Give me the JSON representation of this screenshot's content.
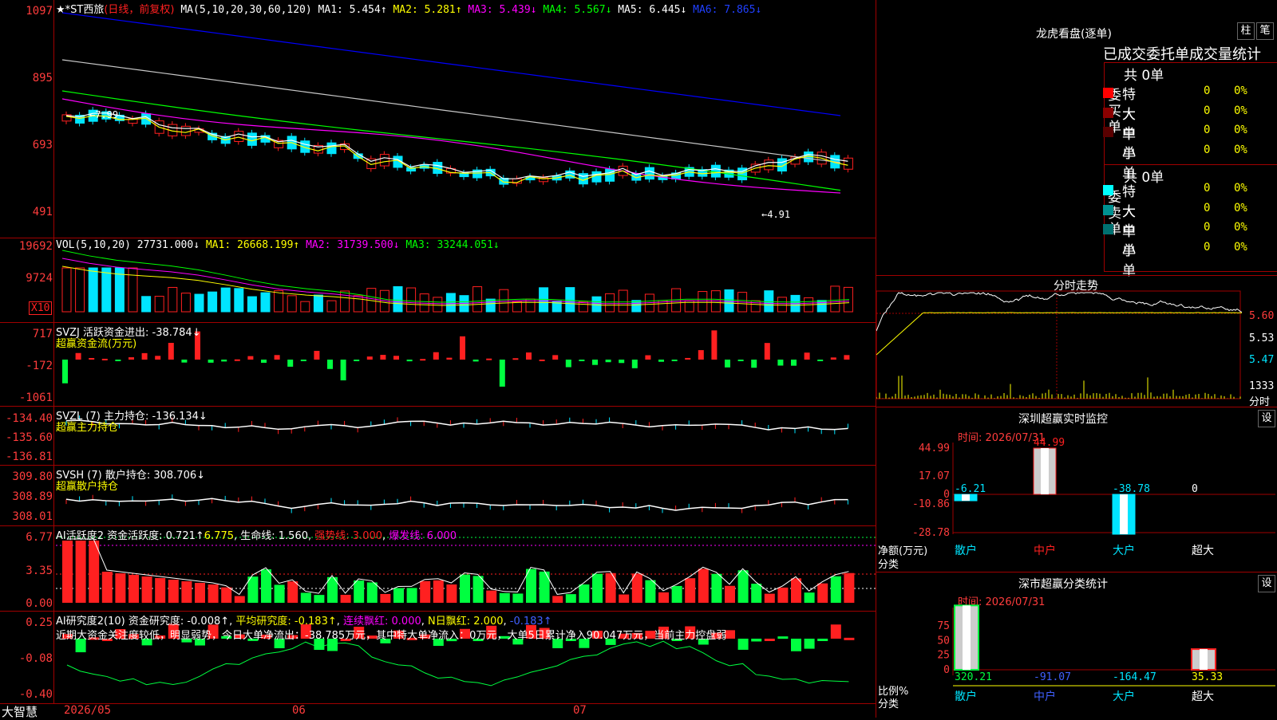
{
  "colors": {
    "up": "#ff2020",
    "down": "#00e5ff",
    "green": "#00ff40",
    "ma1": "#ffffff",
    "ma2": "#ffff00",
    "ma3": "#ff00ff",
    "ma4": "#00ff00",
    "ma5": "#ffffff",
    "ma6": "#0000ff",
    "yellow": "#ffff00",
    "grid": "#a00000"
  },
  "kline": {
    "title_star": "★*ST西旅",
    "period": "(日线，前复权)",
    "ma_label": "MA(5,10,20,30,60,120)",
    "ma1": "MA1: 5.454↑",
    "ma2": "MA2: 5.281↑",
    "ma3": "MA3: 5.439↓",
    "ma4": "MA4: 5.567↓",
    "ma5": "MA5: 6.445↓",
    "ma6": "MA6: 7.865↓",
    "y_ticks": [
      "1097",
      "895",
      "693",
      "491"
    ],
    "high_label": "←7.99",
    "low_label": "←4.91"
  },
  "vol": {
    "label": "VOL(5,10,20)",
    "value": "27731.000↓",
    "ma1": "MA1: 26668.199↑",
    "ma2": "MA2: 31739.500↓",
    "ma3": "MA3: 33244.051↓",
    "y_ticks": [
      "19692",
      "9724"
    ],
    "unit": "X10"
  },
  "svzj": {
    "label": "SVZJ  活跃资金进出: -38.784↓",
    "sub": "超赢资金流(万元)",
    "y_ticks": [
      "717",
      "-172",
      "-1061"
    ]
  },
  "svzl": {
    "label": "SVZL (7) 主力持仓: -136.134↓",
    "sub": "超赢主力持仓",
    "y_ticks": [
      "-134.40",
      "-135.60",
      "-136.81"
    ]
  },
  "svsh": {
    "label": "SVSH (7) 散户持仓: 308.706↓",
    "sub": "超赢散户持仓",
    "y_ticks": [
      "309.80",
      "308.89",
      "308.01"
    ]
  },
  "ai1": {
    "label": "AI活跃度2 资金活跃度: 0.721↑",
    "v2": "6.775",
    "v3": "生命线: 1.560",
    "v4": "强势线: 3.000",
    "v5": "爆发线: 6.000",
    "y_ticks": [
      "6.77",
      "3.35",
      "0.00"
    ]
  },
  "ai2": {
    "label": "AI研究度2(10) 资金研究度: -0.008↑",
    "v2": "平均研究度: -0.183↑",
    "v3": "连续飘红: 0.000",
    "v4": "N日飘红: 2.000",
    "v5": "-0.183↑",
    "note": "近期大资金关注度较低，明显弱势，今日大单净流出：-38.785万元，其中特大单净流入：0万元，大单5日累计净入90.047万元，当前主力控盘弱",
    "y_ticks": [
      "0.25",
      "-0.08",
      "-0.40"
    ]
  },
  "bottom": {
    "brand": "大智慧",
    "dates": [
      "2026/05",
      "06",
      "07"
    ]
  },
  "dragon": {
    "title": "龙虎看盘(逐单)",
    "btn1": "柱",
    "btn2": "笔",
    "tabs": "已成交委托单成交量统计",
    "buy_total": "共 0单",
    "sell_total": "共 0单",
    "buy_label": "委买单",
    "sell_label": "委卖单",
    "rows": [
      {
        "name": "特大",
        "count": "0",
        "pct": "0%"
      },
      {
        "name": "大单",
        "count": "0",
        "pct": "0%"
      },
      {
        "name": "中单",
        "count": "0",
        "pct": "0%"
      },
      {
        "name": "小单",
        "count": "0",
        "pct": "0%"
      }
    ]
  },
  "intraday": {
    "title": "分时走势",
    "prices": [
      "5.60",
      "5.53",
      "5.47"
    ],
    "vol": "1333",
    "vol_label": "分时"
  },
  "monitor": {
    "title": "深圳超赢实时监控",
    "btn": "设",
    "time": "时间: 2026/07/31",
    "y_ticks": [
      "44.99",
      "17.07",
      "0",
      "-10.86",
      "-28.78"
    ],
    "unit": "净额(万元)",
    "cat_label": "分类",
    "categories": [
      "散户",
      "中户",
      "大户",
      "超大"
    ],
    "values": [
      "-6.21",
      "44.99",
      "-38.78",
      "0"
    ],
    "num_values": [
      -6.21,
      44.99,
      -38.78,
      0
    ]
  },
  "classify": {
    "title": "深市超赢分类统计",
    "btn": "设",
    "time": "时间: 2026/07/31",
    "y_ticks": [
      "75",
      "50",
      "25",
      "0"
    ],
    "unit": "比例%",
    "cat_label": "分类",
    "categories": [
      "散户",
      "中户",
      "大户",
      "超大"
    ],
    "values": [
      "320.21",
      "-91.07",
      "-164.47",
      "35.33"
    ],
    "num_values": [
      320.21,
      -91.07,
      -164.47,
      35.33
    ]
  }
}
